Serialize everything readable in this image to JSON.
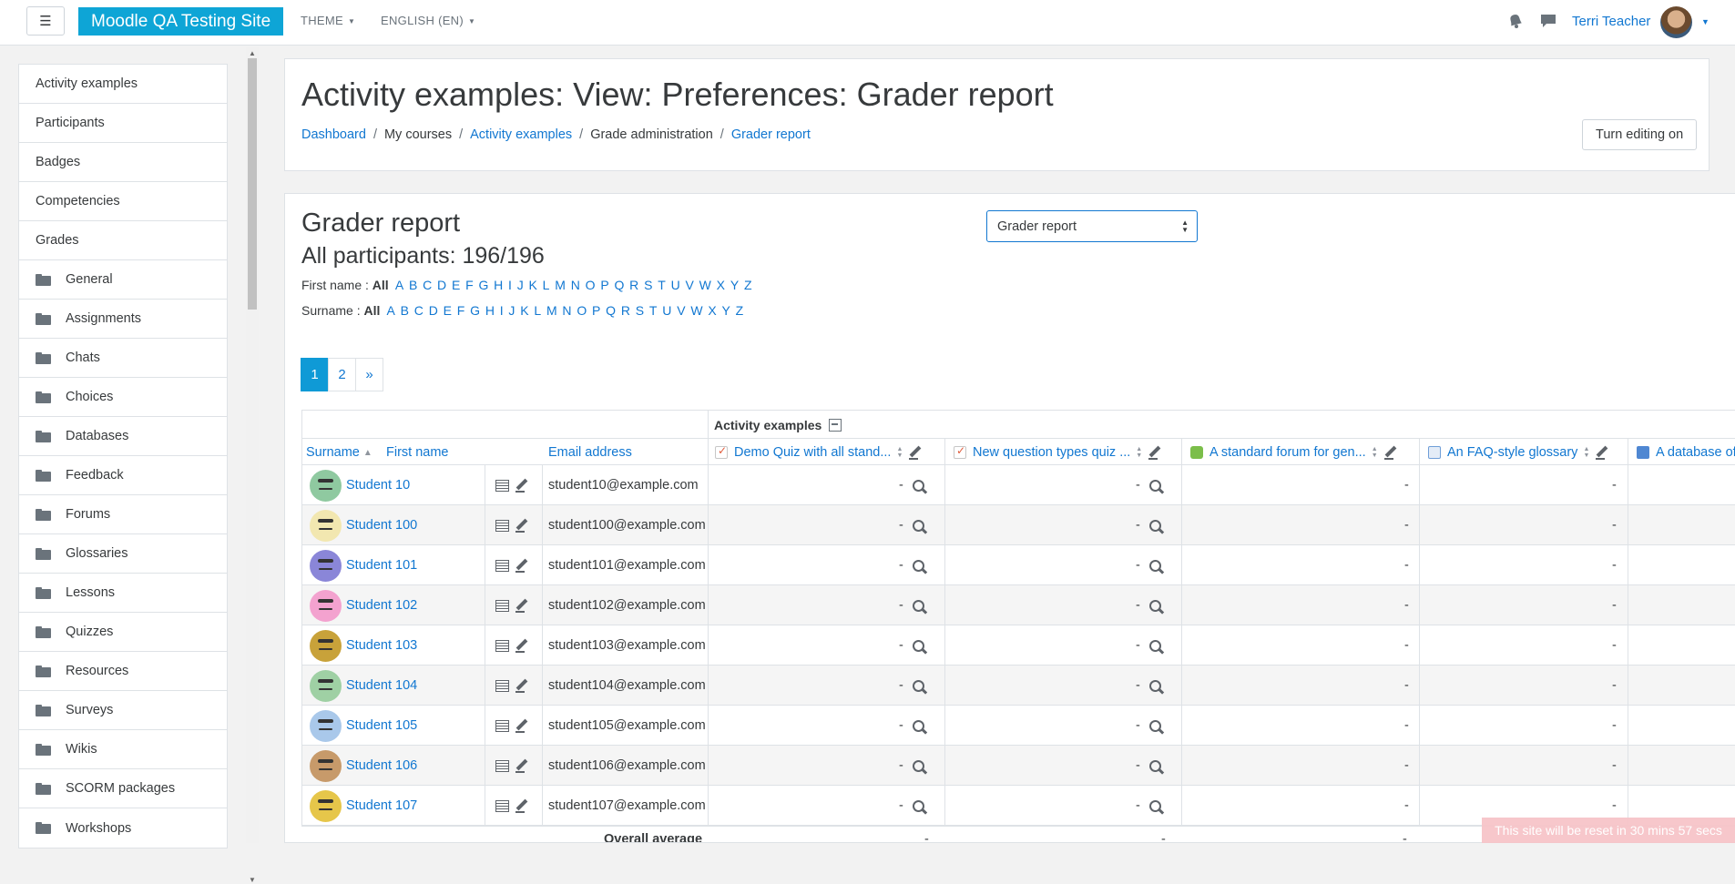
{
  "navbar": {
    "menu_icon": "☰",
    "brand": "Moodle QA Testing Site",
    "theme_label": "THEME",
    "language_label": "ENGLISH (EN)",
    "user_name": "Terri Teacher",
    "icons": [
      "bell-icon",
      "chat-icon",
      "chevron-down-icon"
    ]
  },
  "sidebar": {
    "items": [
      {
        "label": "Activity examples",
        "folder": false
      },
      {
        "label": "Participants",
        "folder": false
      },
      {
        "label": "Badges",
        "folder": false
      },
      {
        "label": "Competencies",
        "folder": false
      },
      {
        "label": "Grades",
        "folder": false
      },
      {
        "label": "General",
        "folder": true
      },
      {
        "label": "Assignments",
        "folder": true
      },
      {
        "label": "Chats",
        "folder": true
      },
      {
        "label": "Choices",
        "folder": true
      },
      {
        "label": "Databases",
        "folder": true
      },
      {
        "label": "Feedback",
        "folder": true
      },
      {
        "label": "Forums",
        "folder": true
      },
      {
        "label": "Glossaries",
        "folder": true
      },
      {
        "label": "Lessons",
        "folder": true
      },
      {
        "label": "Quizzes",
        "folder": true
      },
      {
        "label": "Resources",
        "folder": true
      },
      {
        "label": "Surveys",
        "folder": true
      },
      {
        "label": "Wikis",
        "folder": true
      },
      {
        "label": "SCORM packages",
        "folder": true
      },
      {
        "label": "Workshops",
        "folder": true
      }
    ]
  },
  "header": {
    "title": "Activity examples: View: Preferences: Grader report",
    "breadcrumb": [
      {
        "label": "Dashboard",
        "link": true
      },
      {
        "label": "My courses",
        "link": false
      },
      {
        "label": "Activity examples",
        "link": true
      },
      {
        "label": "Grade administration",
        "link": false
      },
      {
        "label": "Grader report",
        "link": true
      }
    ],
    "edit_button": "Turn editing on"
  },
  "report": {
    "title": "Grader report",
    "participants": "All participants: 196/196",
    "select_value": "Grader report",
    "firstname_label": "First name :",
    "surname_label": "Surname :",
    "all_label": "All",
    "letters": [
      "A",
      "B",
      "C",
      "D",
      "E",
      "F",
      "G",
      "H",
      "I",
      "J",
      "K",
      "L",
      "M",
      "N",
      "O",
      "P",
      "Q",
      "R",
      "S",
      "T",
      "U",
      "V",
      "W",
      "X",
      "Y",
      "Z"
    ],
    "pages": [
      "1",
      "2",
      "»"
    ],
    "category": "Activity examples",
    "columns": {
      "surname": "Surname",
      "firstname": "First name",
      "email": "Email address",
      "items": [
        {
          "label": "Demo Quiz with all stand...",
          "type": "quiz"
        },
        {
          "label": "New question types quiz ...",
          "type": "quiz"
        },
        {
          "label": "A standard forum for gen...",
          "type": "forum"
        },
        {
          "label": "An FAQ-style glossary",
          "type": "glossary"
        },
        {
          "label": "A database of",
          "type": "data"
        }
      ]
    },
    "rows": [
      {
        "name": "Student 10",
        "email": "student10@example.com",
        "color": "#8fc9a0"
      },
      {
        "name": "Student 100",
        "email": "student100@example.com",
        "color": "#f2e7b0"
      },
      {
        "name": "Student 101",
        "email": "student101@example.com",
        "color": "#8a86d8"
      },
      {
        "name": "Student 102",
        "email": "student102@example.com",
        "color": "#f3a2cf"
      },
      {
        "name": "Student 103",
        "email": "student103@example.com",
        "color": "#c8a23a"
      },
      {
        "name": "Student 104",
        "email": "student104@example.com",
        "color": "#9fd0a4"
      },
      {
        "name": "Student 105",
        "email": "student105@example.com",
        "color": "#a9c8ea"
      },
      {
        "name": "Student 106",
        "email": "student106@example.com",
        "color": "#c79a6a"
      },
      {
        "name": "Student 107",
        "email": "student107@example.com",
        "color": "#e6c64a"
      }
    ],
    "grade_value": "-",
    "overall_label": "Overall average"
  },
  "reset_notice": "This site will be reset in 30 mins 57 secs"
}
